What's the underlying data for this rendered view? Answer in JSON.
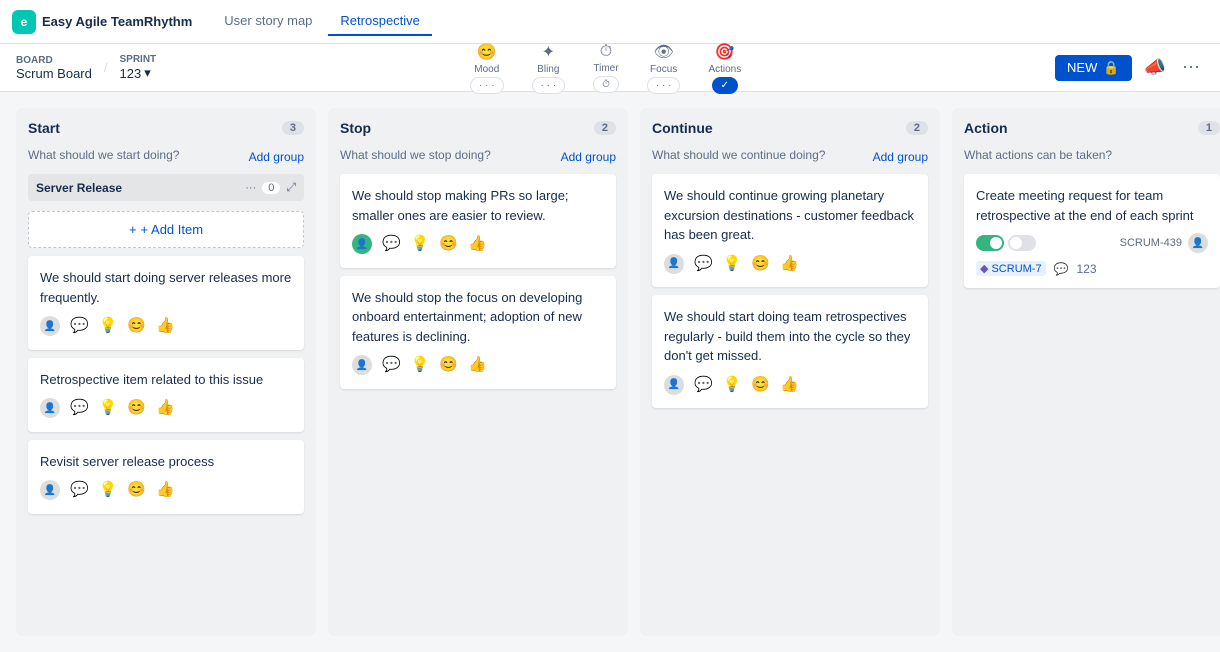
{
  "app": {
    "logo_letter": "e",
    "name": "Easy Agile TeamRhythm",
    "tabs": [
      {
        "label": "User story map",
        "active": false
      },
      {
        "label": "Retrospective",
        "active": true
      }
    ]
  },
  "subheader": {
    "board_label": "BOARD",
    "board_name": "Scrum Board",
    "sprint_label": "SPRINT",
    "sprint_value": "123",
    "toolbar_items": [
      {
        "label": "Mood",
        "icon": "😊",
        "pill": "...",
        "active": false
      },
      {
        "label": "Bling",
        "icon": "✨",
        "pill": "...",
        "active": false
      },
      {
        "label": "Timer",
        "icon": "⏱",
        "pill": "...",
        "active": false
      },
      {
        "label": "Focus",
        "icon": "👁",
        "pill": "...",
        "active": false
      },
      {
        "label": "Actions",
        "icon": "🎯",
        "pill": "...",
        "active": true
      }
    ],
    "btn_new": "NEW"
  },
  "columns": [
    {
      "id": "start",
      "title": "Start",
      "count": 3,
      "subtitle": "What should we start doing?",
      "add_group_label": "Add group",
      "groups": [
        {
          "name": "Server Release",
          "count": 0,
          "items": []
        }
      ],
      "cards": [
        {
          "text": "We should start doing server releases more frequently."
        },
        {
          "text": "Retrospective item related to this issue"
        },
        {
          "text": "Revisit server release process"
        }
      ],
      "add_item_label": "+ Add Item"
    },
    {
      "id": "stop",
      "title": "Stop",
      "count": 2,
      "subtitle": "What should we stop doing?",
      "add_group_label": "Add group",
      "cards": [
        {
          "text": "We should stop making PRs so large; smaller ones are easier to review."
        },
        {
          "text": "We should stop the focus on developing onboard entertainment; adoption of new features is declining."
        }
      ]
    },
    {
      "id": "continue",
      "title": "Continue",
      "count": 2,
      "subtitle": "What should we continue doing?",
      "add_group_label": "Add group",
      "cards": [
        {
          "text": "We should continue growing planetary excursion destinations - customer feedback has been great."
        },
        {
          "text": "We should start doing team retrospectives regularly - build them into the cycle so they don't get missed."
        }
      ]
    },
    {
      "id": "action",
      "title": "Action",
      "count": 1,
      "subtitle": "What actions can be taken?",
      "action_cards": [
        {
          "text": "Create meeting request for team retrospective at the end of each sprint",
          "issue": "SCRUM-439",
          "done": true,
          "cancel": false
        }
      ],
      "action_link": {
        "badge_label": "SCRUM-7",
        "link_label": "123"
      }
    }
  ],
  "icons": {
    "chevron_down": "▾",
    "more": "•••",
    "expand": "⤢",
    "plus": "+",
    "comment": "💬",
    "bulb": "💡",
    "emoji": "😊",
    "thumbs": "👍",
    "avatar": "👤",
    "comment_small": "○",
    "lock": "🔒",
    "megaphone": "📣",
    "ellipsis": "⋯"
  }
}
